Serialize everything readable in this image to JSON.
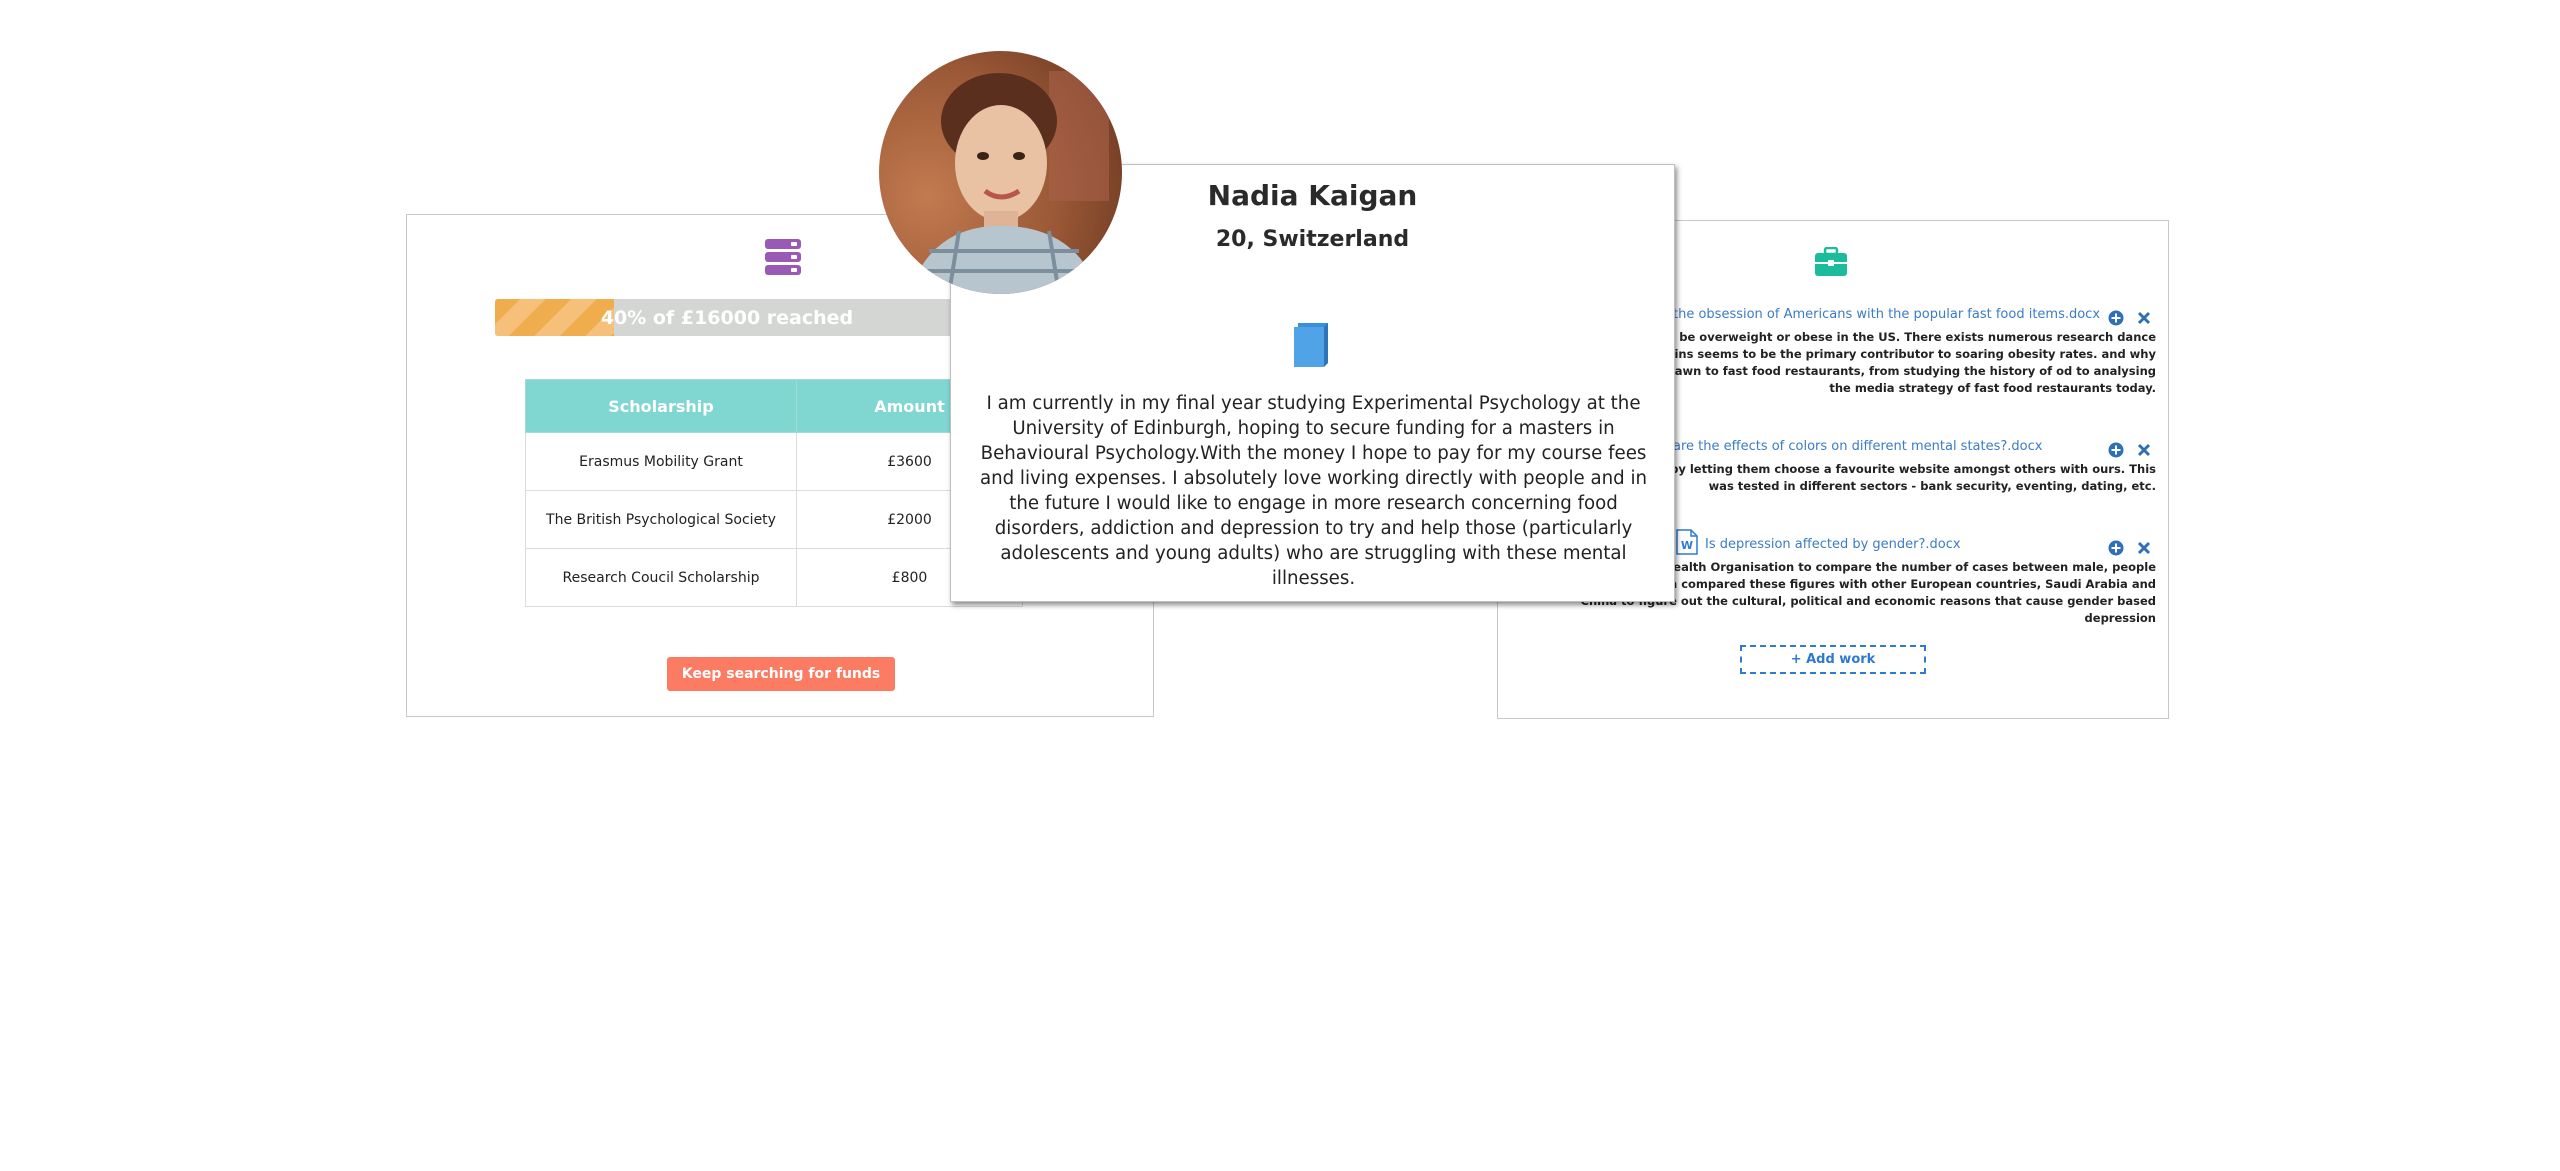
{
  "profile": {
    "name": "Nadia Kaigan",
    "location": "20, Switzerland",
    "bio": "I am currently in my final year studying Experimental Psychology at the University of Edinburgh, hoping to secure funding for a masters in Behavioural Psychology.With the money I hope to pay for my course fees and living expenses. I absolutely love working directly with people and in the future I would like to engage in more research concerning food disorders, addiction and depression to try and help those (particularly adolescents and young adults) who are struggling with these mental illnesses."
  },
  "funding": {
    "progress_label": "40% of £16000 reached",
    "progress_fraction": 0.4,
    "columns": [
      "Scholarship",
      "Amount"
    ],
    "rows": [
      {
        "name": "Erasmus Mobility Grant",
        "amount": "£3600"
      },
      {
        "name": "The British Psychological Society",
        "amount": "£2000"
      },
      {
        "name": "Research Coucil Scholarship",
        "amount": "£800"
      }
    ],
    "button_label": "Keep searching for funds"
  },
  "work": {
    "items": [
      {
        "title": "the obsession of Americans with the popular fast food items.docx",
        "desc": "ts are considered to be overweight or obese in the US. There exists numerous research dance of fast food chains seems to be the primary contributor to soaring obesity rates. and why americans are so drawn to fast food restaurants, from studying the history of od to analysing the media strategy of fast food restaurants today."
      },
      {
        "title": "are the effects of colors on different mental states?.docx",
        "desc": "nt with 30 students by letting them choose a favourite website amongst others with ours. This was tested in different sectors - bank security, eventing, dating, etc."
      },
      {
        "title": "Is depression affected by gender?.docx",
        "desc": "s from the Mental Health Organisation to compare the number of cases between male, people in the UK. I then compared these figures with other European countries, Saudi Arabia and China to figure out the cultural, political and economic reasons that cause gender based depression"
      }
    ],
    "add_label": "+ Add work"
  },
  "colors": {
    "accent_teal": "#80d7d1",
    "progress_orange": "#f0ad4e",
    "button_coral": "#fb7b63",
    "link_blue": "#3a7cc7",
    "stack_icon_purple": "#9b59b6",
    "briefcase_teal": "#1abc9c",
    "book_blue": "#3b8fd9"
  },
  "icons": [
    "stack-icon",
    "briefcase-icon",
    "book-icon",
    "word-doc-icon",
    "plus-circle-icon",
    "close-icon"
  ]
}
